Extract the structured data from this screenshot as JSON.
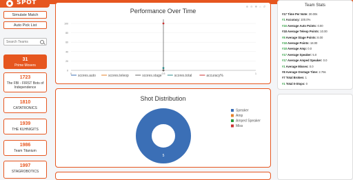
{
  "app": {
    "logo_text": "SPOT"
  },
  "sidebar": {
    "buttons": [
      "Simulate Match",
      "Auto Pick List"
    ],
    "search_placeholder": "Search Teams",
    "teams": [
      {
        "number": "31",
        "name": "Prime Movers",
        "selected": true
      },
      {
        "number": "1723",
        "name": "The FBI - FIRST Bots of Independence",
        "selected": false
      },
      {
        "number": "1810",
        "name": "CATATRONICS",
        "selected": false
      },
      {
        "number": "1939",
        "name": "THE KUHNIGITS",
        "selected": false
      },
      {
        "number": "1986",
        "name": "Team Titanium",
        "selected": false
      },
      {
        "number": "1997",
        "name": "STAGROBOTICS",
        "selected": false
      }
    ]
  },
  "performance": {
    "title": "Performance Over Time",
    "legend": [
      "scores.auto",
      "scores.teleop",
      "scores.stage",
      "scores.total",
      "accuracy%"
    ],
    "legend_colors": [
      "#3b6fb6",
      "#e6822a",
      "#666666",
      "#2a8a8a",
      "#cc3333"
    ],
    "y_ticks": [
      "100",
      "80",
      "60",
      "40",
      "20",
      "0"
    ],
    "x_ticks": [
      "0",
      "0.5",
      "1"
    ],
    "toolbar_icons": [
      "zoom-in-icon",
      "zoom-out-icon",
      "pan-icon",
      "reset-icon",
      "home-icon"
    ]
  },
  "shot_distribution": {
    "title": "Shot Distribution",
    "slice_label": "5",
    "legend": [
      {
        "label": "Speaker",
        "color": "#3b6fb6"
      },
      {
        "label": "Amp",
        "color": "#e6822a"
      },
      {
        "label": "Amped Speaker",
        "color": "#2a9a3c"
      },
      {
        "label": "Miss",
        "color": "#cc3333"
      }
    ]
  },
  "chart_data": [
    {
      "type": "line",
      "title": "Performance Over Time",
      "x": [
        0.5
      ],
      "series": [
        {
          "name": "scores.auto",
          "values": [
            0
          ]
        },
        {
          "name": "scores.teleop",
          "values": [
            0
          ]
        },
        {
          "name": "scores.stage",
          "values": [
            0
          ]
        },
        {
          "name": "scores.total",
          "values": [
            5
          ]
        },
        {
          "name": "accuracy%",
          "values": [
            100
          ]
        }
      ],
      "ylim": [
        0,
        100
      ],
      "xlim": [
        0,
        1
      ],
      "legend": "bottom"
    },
    {
      "type": "pie",
      "title": "Shot Distribution",
      "categories": [
        "Speaker",
        "Amp",
        "Amped Speaker",
        "Miss"
      ],
      "values": [
        5,
        0,
        0,
        0
      ],
      "legend": "right"
    }
  ],
  "team_stats": {
    "title": "Team Stats",
    "rows": [
      {
        "rank": "#17",
        "label": "Time Per Note:",
        "value": "30.00s",
        "top": true
      },
      {
        "rank": "#1",
        "label": "Accuracy:",
        "value": "100.0%",
        "top": false
      },
      {
        "rank": "#16",
        "label": "Average Auto Points:",
        "value": "0.00",
        "top": false
      },
      {
        "rank": "#18",
        "label": "Average Teleop Points:",
        "value": "10.00",
        "top": true
      },
      {
        "rank": "#8",
        "label": "Average Stage Points:",
        "value": "8.00",
        "top": false
      },
      {
        "rank": "#18",
        "label": "Average Points:",
        "value": "18.00",
        "top": false
      },
      {
        "rank": "#18",
        "label": "Average Amp:",
        "value": "0.0",
        "top": false
      },
      {
        "rank": "#17",
        "label": "Average Speaker:",
        "value": "5.0",
        "top": false
      },
      {
        "rank": "#17",
        "label": "Average Amped Speaker:",
        "value": "0.0",
        "top": false
      },
      {
        "rank": "#1",
        "label": "Average Misses:",
        "value": "0.0",
        "top": false
      },
      {
        "rank": "#8",
        "label": "Average Onstage Time:",
        "value": "2.76s",
        "top": true
      },
      {
        "rank": "#7",
        "label": "Total Broken:",
        "value": "1",
        "top": true
      },
      {
        "rank": "#1",
        "label": "Total 0-Stops:",
        "value": "0",
        "top": false
      }
    ]
  }
}
